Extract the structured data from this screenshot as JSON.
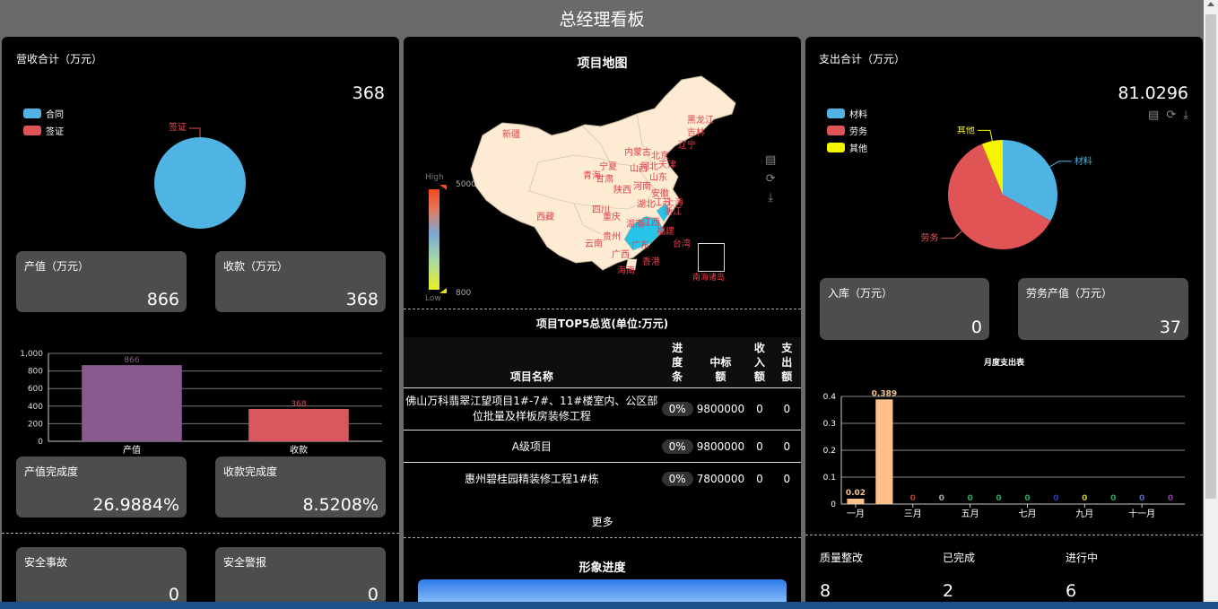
{
  "page": {
    "title": "总经理看板"
  },
  "left": {
    "revenue": {
      "title": "营收合计（万元）",
      "total": "368",
      "legend": [
        {
          "name": "合同",
          "color": "#4fb3e4"
        },
        {
          "name": "签证",
          "color": "#e05456"
        }
      ],
      "pie_label": "签证"
    },
    "cards1": [
      {
        "label": "产值（万元）",
        "value": "866"
      },
      {
        "label": "收款（万元）",
        "value": "368"
      }
    ],
    "cards2": [
      {
        "label": "产值完成度",
        "value": "26.9884%"
      },
      {
        "label": "收款完成度",
        "value": "8.5208%"
      }
    ],
    "safety": [
      {
        "label": "安全事故",
        "value": "0"
      },
      {
        "label": "安全警报",
        "value": "0"
      }
    ]
  },
  "middle": {
    "map": {
      "title": "项目地图",
      "legend_high": "High",
      "legend_low": "Low",
      "legend_max": "50000",
      "legend_min": "800",
      "south_sea_label": "南海诸岛"
    },
    "map_labels": [
      "黑龙江",
      "吉林",
      "辽宁",
      "内蒙古",
      "北京",
      "天津",
      "河北",
      "山西",
      "山东",
      "新疆",
      "宁夏",
      "甘肃",
      "青海",
      "陕西",
      "河南",
      "江苏",
      "安徽",
      "上海",
      "湖北",
      "浙江",
      "四川",
      "重庆",
      "湖南",
      "江西",
      "西藏",
      "贵州",
      "福建",
      "云南",
      "广西",
      "广东",
      "台湾",
      "香港",
      "海南"
    ],
    "top5": {
      "title": "项目TOP5总览(单位:万元)",
      "headers": [
        "项目名称",
        "进度条",
        "中标额",
        "收入额",
        "支出额"
      ],
      "rows": [
        {
          "name": "佛山万科翡翠江望项目1#-7#、11#楼室内、公区部位批量及样板房装修工程",
          "progress": "0%",
          "bid": "9800000",
          "income": "0",
          "expense": "0"
        },
        {
          "name": "A级项目",
          "progress": "0%",
          "bid": "9800000",
          "income": "0",
          "expense": "0"
        },
        {
          "name": "惠州碧桂园精装修工程1#栋",
          "progress": "0%",
          "bid": "7800000",
          "income": "0",
          "expense": "0"
        }
      ],
      "more": "更多"
    },
    "progress_title": "形象进度"
  },
  "right": {
    "expense": {
      "title": "支出合计（万元）",
      "total": "81.0296",
      "legend": [
        {
          "name": "材料",
          "color": "#4fb3e4"
        },
        {
          "name": "劳务",
          "color": "#e05456"
        },
        {
          "name": "其他",
          "color": "#f5f500"
        }
      ],
      "pie_labels": {
        "material": "材料",
        "labor": "劳务",
        "other": "其他"
      }
    },
    "cards": [
      {
        "label": "入库（万元）",
        "value": "0"
      },
      {
        "label": "劳务产值（万元）",
        "value": "37"
      }
    ],
    "monthly_title": "月度支出表",
    "quality": [
      {
        "label": "质量整改",
        "value": "8"
      },
      {
        "label": "已完成",
        "value": "2"
      },
      {
        "label": "进行中",
        "value": "6"
      }
    ]
  },
  "chart_data": [
    {
      "type": "pie",
      "categories": [
        "合同",
        "签证"
      ],
      "values": [
        368,
        0
      ],
      "colors": [
        "#4fb3e4",
        "#e05456"
      ]
    },
    {
      "type": "bar",
      "categories": [
        "产值",
        "收款"
      ],
      "values": [
        866,
        368
      ],
      "colors": [
        "#8a5a8e",
        "#d9575e"
      ],
      "ylim": [
        0,
        1000
      ],
      "yticks": [
        "0",
        "200",
        "400",
        "600",
        "800",
        "1,000"
      ],
      "data_labels": [
        "866",
        "368"
      ],
      "grid": true
    },
    {
      "type": "pie",
      "categories": [
        "材料",
        "劳务",
        "其他"
      ],
      "values": [
        26.7,
        49.3,
        5.0
      ],
      "colors": [
        "#4fb3e4",
        "#e05456",
        "#f5f500"
      ]
    },
    {
      "type": "bar",
      "title": "月度支出表",
      "categories": [
        "一月",
        "二月",
        "三月",
        "四月",
        "五月",
        "六月",
        "七月",
        "八月",
        "九月",
        "十月",
        "十一月",
        "十二月"
      ],
      "tick_labels": [
        "一月",
        "三月",
        "五月",
        "七月",
        "九月",
        "十一月"
      ],
      "values": [
        0.02,
        0.389,
        0,
        0,
        0,
        0,
        0,
        0,
        0,
        0,
        0,
        0
      ],
      "data_labels": [
        "0.02",
        "0.389",
        "0",
        "0",
        "0",
        "0",
        "0",
        "0",
        "0",
        "0",
        "0",
        "0"
      ],
      "label_colors": [
        "#f5c28a",
        "#f5c28a",
        "#c0392b",
        "#aaaaaa",
        "#27ae60",
        "#27ae60",
        "#27ae60",
        "#2a3fbf",
        "#c6c62a",
        "#27ae60",
        "#5a6abf",
        "#8e3aa0"
      ],
      "bar_color": "#ffc08a",
      "ylim": [
        0,
        0.4
      ],
      "yticks": [
        "0",
        "0.1",
        "0.2",
        "0.3",
        "0.4"
      ],
      "grid": true
    }
  ]
}
